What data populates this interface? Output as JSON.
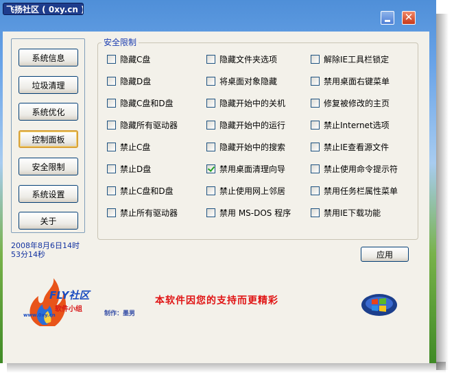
{
  "window": {
    "title": "飞扬社区 ( 0xy.cn )",
    "close_glyph": "✕"
  },
  "nav": {
    "items": [
      {
        "label": "系统信息"
      },
      {
        "label": "垃圾清理"
      },
      {
        "label": "系统优化"
      },
      {
        "label": "控制面板",
        "active": true
      },
      {
        "label": "安全限制"
      },
      {
        "label": "系统设置"
      },
      {
        "label": "关于"
      }
    ]
  },
  "datetime": {
    "line1": "2008年8月6日14时",
    "line2": "53分14秒"
  },
  "security": {
    "legend": "安全限制",
    "options": [
      {
        "label": "隐藏C盘",
        "checked": false
      },
      {
        "label": "隐藏文件夹选项",
        "checked": false
      },
      {
        "label": "解除IE工具栏锁定",
        "checked": false
      },
      {
        "label": "隐藏D盘",
        "checked": false
      },
      {
        "label": "将桌面对象隐藏",
        "checked": false
      },
      {
        "label": "禁用桌面右键菜单",
        "checked": false
      },
      {
        "label": "隐藏C盘和D盘",
        "checked": false
      },
      {
        "label": "隐藏开始中的关机",
        "checked": false
      },
      {
        "label": "修复被修改的主页",
        "checked": false
      },
      {
        "label": "隐藏所有驱动器",
        "checked": false
      },
      {
        "label": "隐藏开始中的运行",
        "checked": false
      },
      {
        "label": "禁止Internet选项",
        "checked": false
      },
      {
        "label": "禁止C盘",
        "checked": false
      },
      {
        "label": "隐藏开始中的搜索",
        "checked": false
      },
      {
        "label": "禁止IE查看源文件",
        "checked": false
      },
      {
        "label": "禁止D盘",
        "checked": false
      },
      {
        "label": "禁用桌面清理向导",
        "checked": true
      },
      {
        "label": "禁止使用命令提示符",
        "checked": false
      },
      {
        "label": "禁止C盘和D盘",
        "checked": false
      },
      {
        "label": "禁止使用网上邻居",
        "checked": false
      },
      {
        "label": "禁用任务栏属性菜单",
        "checked": false
      },
      {
        "label": "禁止所有驱动器",
        "checked": false
      },
      {
        "label": "禁用 MS-DOS 程序",
        "checked": false
      },
      {
        "label": "禁用IE下载功能",
        "checked": false
      }
    ],
    "apply_label": "应用"
  },
  "footer": {
    "brand": "FLY社区",
    "group": "软件小组",
    "url": "www.0xy.cn",
    "author": "制作：墨男",
    "slogan": "本软件因您的支持而更精彩"
  },
  "colors": {
    "legend": "#1a3cb0",
    "datetime": "#1030a0",
    "slogan": "#e01414",
    "title_badge": "#1e3c8c",
    "check": "#21a121"
  },
  "icons": {
    "minimize": "minimize-icon",
    "close": "close-icon",
    "logo": "fly-flame-logo",
    "windows": "windows-flag-logo"
  }
}
